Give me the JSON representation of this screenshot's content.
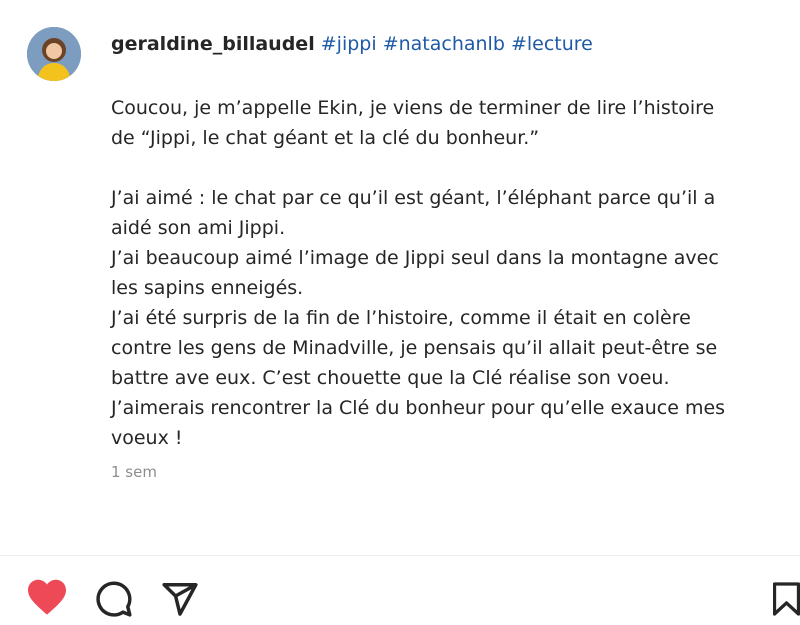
{
  "post": {
    "username": "geraldine_billaudel",
    "hashtags": [
      "#jippi",
      "#natachanlb",
      "#lecture"
    ],
    "caption_lines": [
      "Coucou, je m’appelle Ekin, je viens de terminer de lire l’histoire",
      "de “Jippi, le chat géant et la clé du bonheur.”",
      "",
      "J’ai aimé : le chat par ce qu’il est géant, l’éléphant parce qu’il a",
      "aidé son ami Jippi.",
      "J’ai beaucoup aimé l’image de Jippi seul dans la montagne avec",
      "les sapins enneigés.",
      "J’ai été surpris de la fin de l’histoire, comme il était en colère",
      "contre les gens de Minadville, je pensais qu’il allait peut-être se",
      "battre ave eux. C’est chouette que la Clé réalise son voeu.",
      "J’aimerais rencontrer la Clé du bonheur pour qu’elle exauce mes",
      "voeux !"
    ],
    "timestamp": "1 sem"
  },
  "actions": {
    "like_icon": "heart-filled-icon",
    "comment_icon": "speech-bubble-icon",
    "share_icon": "paper-plane-icon",
    "save_icon": "bookmark-icon"
  },
  "colors": {
    "like_red": "#ed4956",
    "hashtag_blue": "#1f5aa6",
    "text": "#262626",
    "muted": "#8e8e8e"
  }
}
